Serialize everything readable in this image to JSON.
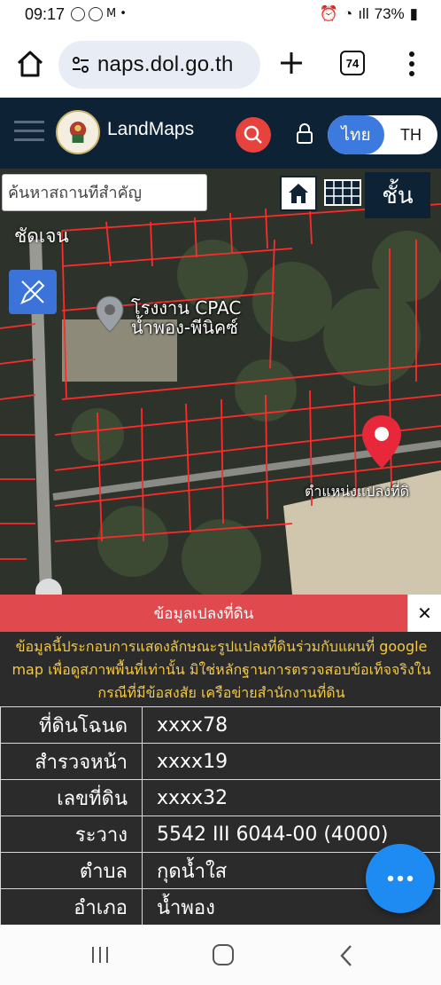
{
  "status_bar": {
    "time": "09:17",
    "battery": "73%"
  },
  "browser": {
    "url": "naps.dol.go.th",
    "tab_count": "74"
  },
  "app": {
    "title": "LandMaps",
    "lang_thai": "ไทย",
    "lang_en": "TH"
  },
  "map": {
    "search_placeholder": "ค้นหาสถานที่สำคัญ",
    "layer_label": "ชั้น",
    "clarity_label": "ชัดเจน",
    "poi_line1": "โรงงาน CPAC",
    "poi_line2": "น้ำพอง-พีนิคซ์",
    "parcel_label": "ตำแหน่งแปลงที่ดิ"
  },
  "parcel_info": {
    "header": "ข้อมูลเปลงที่ดิน",
    "close_symbol": "✕",
    "disclaimer": "ข้อมูลนี้ประกอบการแสดงลักษณะรูปแปลงที่ดินร่วมกับแผนที่ google map เพื่อดูสภาพพื้นที่เท่านั้น มิใช่หลักฐานการตรวจสอบข้อเท็จจริงในกรณีที่มีข้อสงสัย เครือข่ายสำนักงานที่ดิน",
    "rows": [
      {
        "label": "ที่ดินโฉนด",
        "value": "xxxx78"
      },
      {
        "label": "สำรวจหน้า",
        "value": "xxxx19"
      },
      {
        "label": "เลขที่ดิน",
        "value": "xxxx32"
      },
      {
        "label": "ระวาง",
        "value": "5542 III 6044-00 (4000)"
      },
      {
        "label": "ตำบล",
        "value": "กุดน้ำใส"
      },
      {
        "label": "อำเภอ",
        "value": "น้ำพอง"
      }
    ]
  },
  "colors": {
    "header_bg": "#0e2236",
    "accent_red": "#e04a4f",
    "fab_blue": "#1d8bf2",
    "disclaimer_yellow": "#f4c842"
  }
}
